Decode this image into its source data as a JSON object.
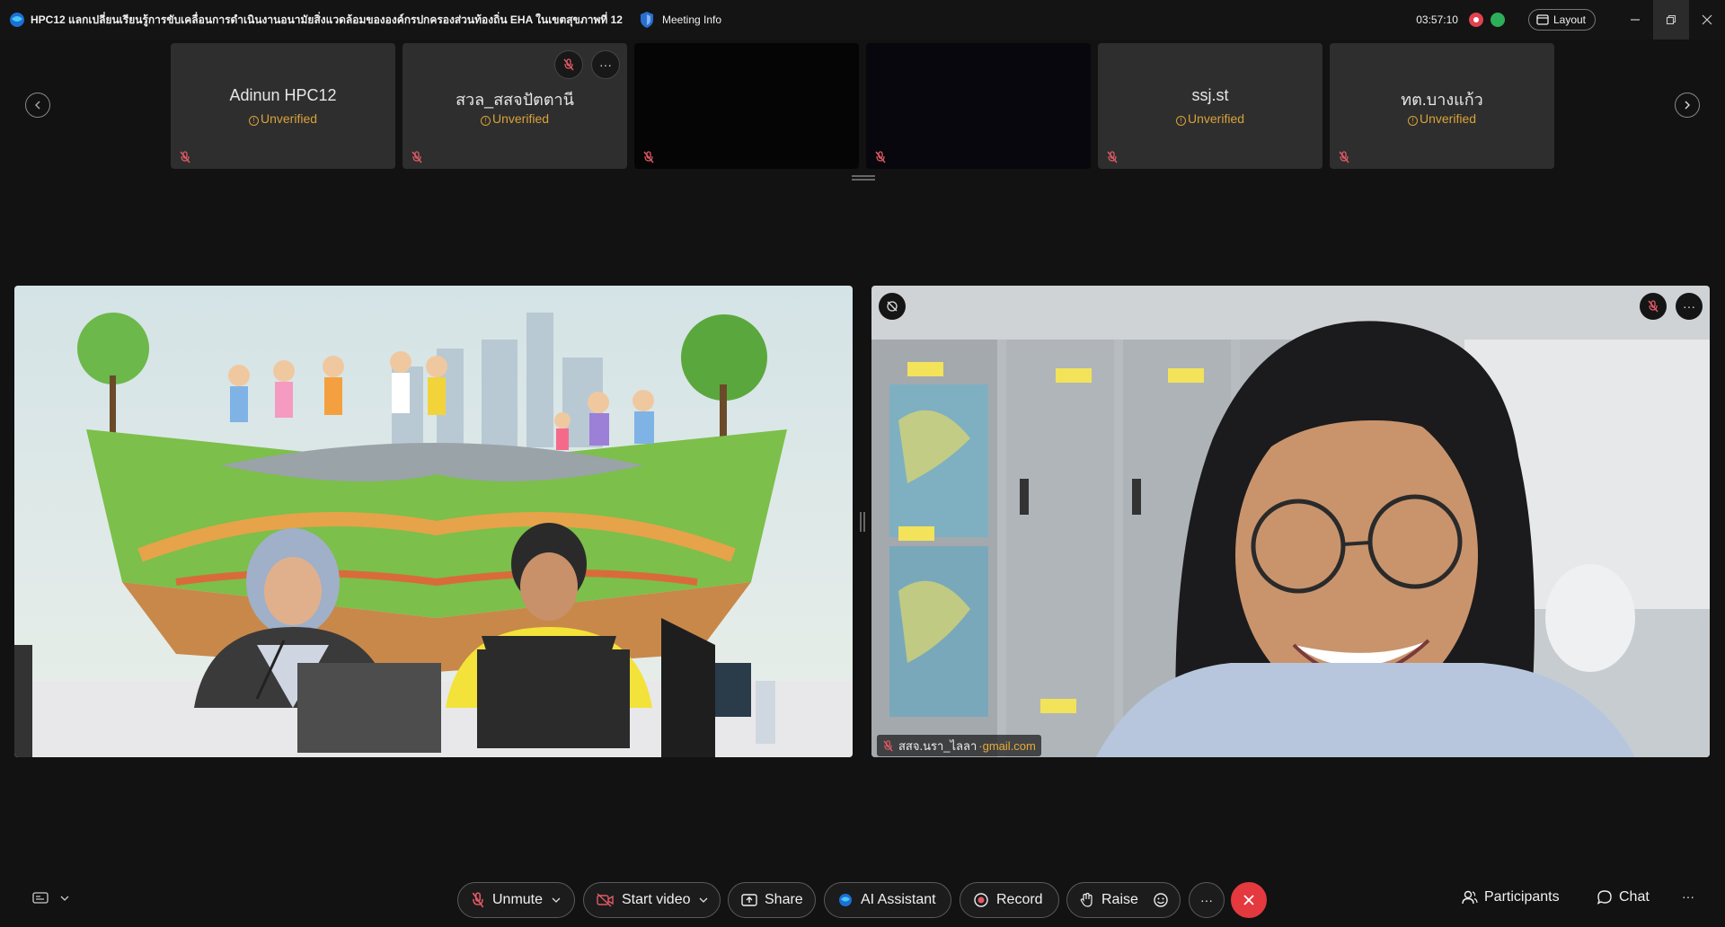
{
  "window": {
    "title": "HPC12 แลกเปลี่ยนเรียนรู้การขับเคลื่อนการดำเนินงานอนามัยสิ่งแวดล้อมขององค์กรปกครองส่วนท้องถิ่น EHA ในเขตสุขภาพที่ 12",
    "meeting_info": "Meeting Info",
    "timer": "03:57:10",
    "layout_label": "Layout"
  },
  "participants_strip": {
    "tiles": [
      {
        "name": "Adinun HPC12",
        "status": "Unverified"
      },
      {
        "name": "สวล_สสจปัตตานี",
        "status": "Unverified"
      },
      {
        "name": "",
        "status": ""
      },
      {
        "name": "",
        "status": ""
      },
      {
        "name": "ssj.st",
        "status": "Unverified"
      },
      {
        "name": "ทต.บางแก้ว",
        "status": "Unverified"
      }
    ]
  },
  "main_videos": {
    "right_name": "สสจ.นรา_ไลลา",
    "right_email": "gmail.com"
  },
  "toolbar": {
    "unmute": "Unmute",
    "start_video": "Start video",
    "share": "Share",
    "ai_assistant": "AI Assistant",
    "record": "Record",
    "raise": "Raise",
    "participants": "Participants",
    "chat": "Chat"
  },
  "colors": {
    "accent_warning": "#d9a23a",
    "end_call": "#e4393f",
    "recording": "#e0434e",
    "connection": "#2fae5a"
  }
}
